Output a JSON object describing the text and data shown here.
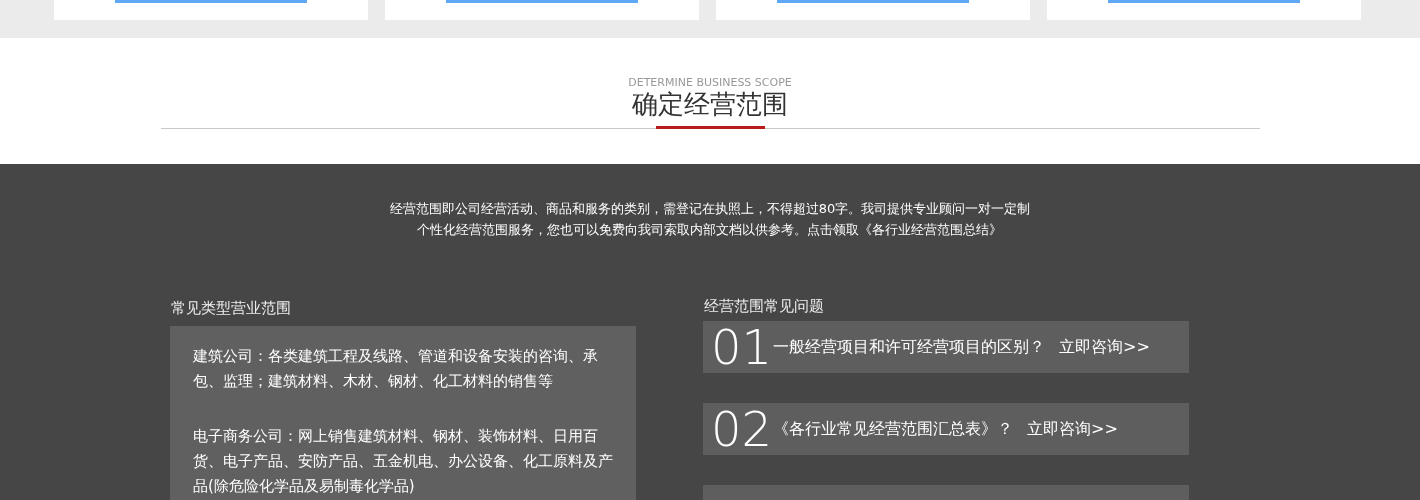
{
  "top_cards": [
    {
      "kind": "card"
    },
    {
      "kind": "card"
    },
    {
      "kind": "card"
    },
    {
      "kind": "card"
    }
  ],
  "section": {
    "subtitle": "DETERMINE BUSINESS SCOPE",
    "title": "确定经营范围"
  },
  "intro": [
    "经营范围即公司经营活动、商品和服务的类别，需登记在执照上，不得超过80字。我司提供专业顾问一对一定制",
    "个性化经营范围服务，您也可以免费向我司索取内部文档以供参考。点击领取《各行业经营范围总结》"
  ],
  "common_scopes": {
    "heading": "常见类型营业范围",
    "paragraphs": [
      "建筑公司：各类建筑工程及线路、管道和设备安装的咨询、承包、监理；建筑材料、木材、钢材、化工材料的销售等",
      "电子商务公司：网上销售建筑材料、钢材、装饰材料、日用百货、电子产品、安防产品、五金机电、办公设备、化工原料及产品(除危险化学品及易制毒化学品)"
    ]
  },
  "faq": {
    "heading": "经营范围常见问题",
    "items": [
      {
        "number": "01",
        "question": "一般经营项目和许可经营项目的区别？",
        "link": "立即咨询>>"
      },
      {
        "number": "02",
        "question": "《各行业常见经营范围汇总表》？",
        "link": "立即咨询>>"
      }
    ]
  }
}
